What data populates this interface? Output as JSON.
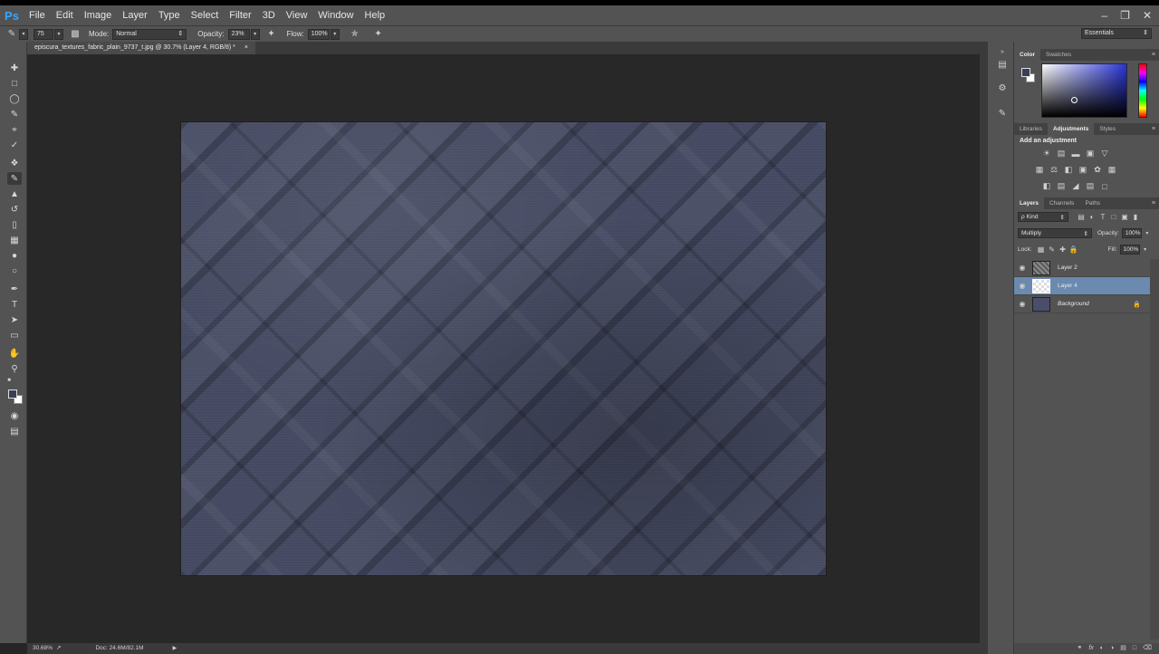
{
  "app": {
    "logo": "Ps"
  },
  "menu": [
    "File",
    "Edit",
    "Image",
    "Layer",
    "Type",
    "Select",
    "Filter",
    "3D",
    "View",
    "Window",
    "Help"
  ],
  "window_controls": {
    "minimize": "–",
    "restore": "❐",
    "close": "✕"
  },
  "options_bar": {
    "brush_size": "75",
    "mode_label": "Mode:",
    "mode_value": "Normal",
    "opacity_label": "Opacity:",
    "opacity_value": "23%",
    "flow_label": "Flow:",
    "flow_value": "100%",
    "workspace": "Essentials"
  },
  "document_tab": {
    "title": "episcura_textures_fabric_plain_9737_t.jpg @ 30.7% (Layer 4, RGB/8) *",
    "close": "×"
  },
  "status_bar": {
    "zoom": "30.68%",
    "doc_size": "Doc: 24.6M/82.1M",
    "arrow": "▶"
  },
  "panels": {
    "color_tabs": [
      "Color",
      "Swatches"
    ],
    "adjustment_tabs": [
      "Libraries",
      "Adjustments",
      "Styles"
    ],
    "adjustments_title": "Add an adjustment",
    "layers_tabs": [
      "Layers",
      "Channels",
      "Paths"
    ],
    "kind_filter": "ρ Kind",
    "blend_mode": "Multiply",
    "opacity_label": "Opacity:",
    "opacity_value": "100%",
    "lock_label": "Lock:",
    "fill_label": "Fill:",
    "fill_value": "100%"
  },
  "layers": [
    {
      "name": "Layer 2",
      "visible": true,
      "selected": false,
      "locked": false
    },
    {
      "name": "Layer 4",
      "visible": true,
      "selected": true,
      "locked": false
    },
    {
      "name": "Background",
      "visible": true,
      "selected": false,
      "locked": true
    }
  ],
  "colors": {
    "foreground": "#3b3e58",
    "background": "#ffffff",
    "selection": "#6a8ab0",
    "brand": "#31a8ff"
  },
  "icons": {
    "tools": [
      "move-icon",
      "marquee-icon",
      "lasso-icon",
      "quick-select-icon",
      "crop-icon",
      "eyedropper-icon",
      "healing-brush-icon",
      "brush-icon",
      "clone-stamp-icon",
      "history-brush-icon",
      "eraser-icon",
      "gradient-icon",
      "blur-icon",
      "dodge-icon",
      "pen-icon",
      "type-icon",
      "path-select-icon",
      "rectangle-icon",
      "hand-icon",
      "zoom-icon"
    ],
    "layers_footer": [
      "link-icon",
      "fx-icon",
      "mask-icon",
      "adjustment-layer-icon",
      "group-icon",
      "new-layer-icon",
      "trash-icon"
    ]
  }
}
